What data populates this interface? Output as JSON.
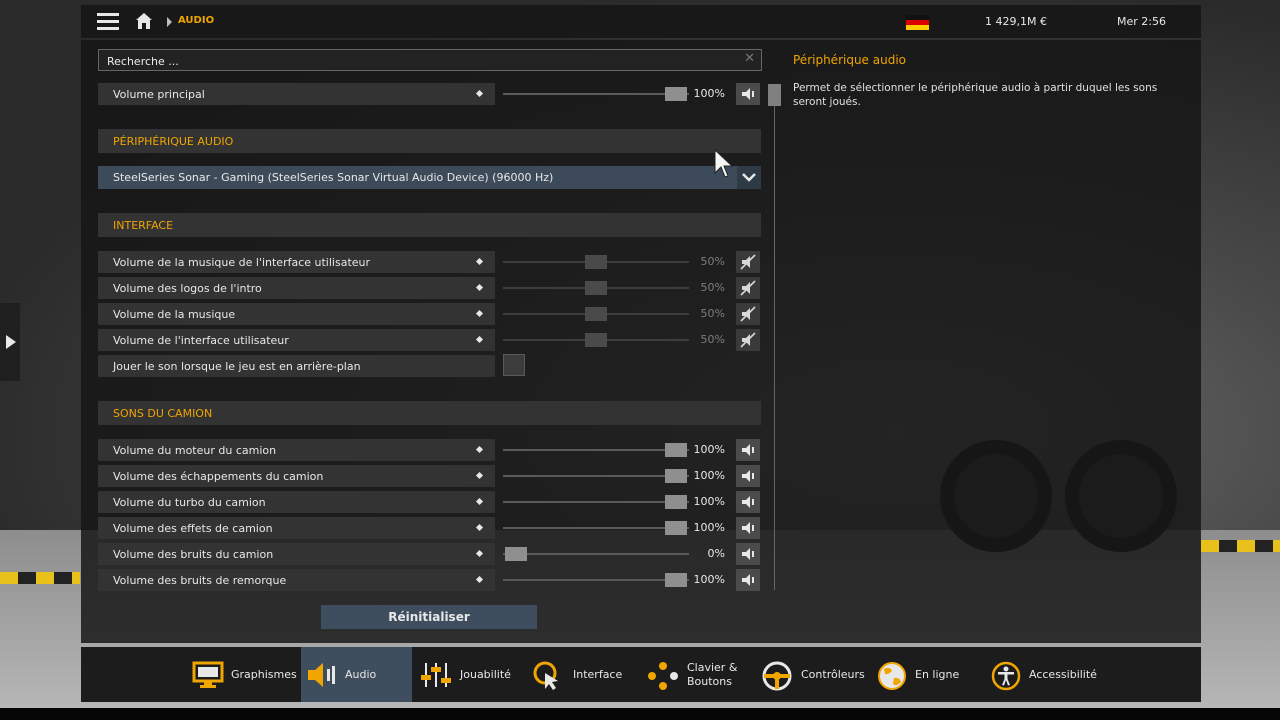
{
  "topbar": {
    "breadcrumb": "AUDIO",
    "money": "1 429,1M  €",
    "clock": "Mer 2:56"
  },
  "search": {
    "placeholder": "Recherche ..."
  },
  "master": {
    "label": "Volume principal",
    "value": "100%",
    "level": 1.0
  },
  "device_section": {
    "title": "PÉRIPHÉRIQUE AUDIO",
    "selected": "SteelSeries Sonar - Gaming (SteelSeries Sonar Virtual Audio Device) (96000 Hz)"
  },
  "interface_section": {
    "title": "INTERFACE",
    "sliders": [
      {
        "label": "Volume de la musique de l'interface utilisateur",
        "value": "50%",
        "level": 0.5
      },
      {
        "label": "Volume des logos de l'intro",
        "value": "50%",
        "level": 0.5
      },
      {
        "label": "Volume de la musique",
        "value": "50%",
        "level": 0.5
      },
      {
        "label": "Volume de l'interface utilisateur",
        "value": "50%",
        "level": 0.5
      }
    ],
    "background_sound_label": "Jouer le son lorsque le jeu est en arrière-plan"
  },
  "truck_section": {
    "title": "SONS DU CAMION",
    "sliders": [
      {
        "label": "Volume du moteur du camion",
        "value": "100%",
        "level": 1.0
      },
      {
        "label": "Volume des échappements du camion",
        "value": "100%",
        "level": 1.0
      },
      {
        "label": "Volume du turbo du camion",
        "value": "100%",
        "level": 1.0
      },
      {
        "label": "Volume des effets de camion",
        "value": "100%",
        "level": 1.0
      },
      {
        "label": "Volume des bruits du camion",
        "value": "0%",
        "level": 0.0
      },
      {
        "label": "Volume des bruits de remorque",
        "value": "100%",
        "level": 1.0
      }
    ]
  },
  "reset_label": "Réinitialiser",
  "info": {
    "title": "Périphérique audio",
    "text": "Permet de sélectionner le périphérique audio à partir duquel les sons seront joués."
  },
  "nav": {
    "graphics": "Graphismes",
    "audio": "Audio",
    "gameplay": "Jouabilité",
    "interface": "Interface",
    "keyboard_line1": "Clavier &",
    "keyboard_line2": "Boutons",
    "controllers": "Contrôleurs",
    "online": "En ligne",
    "accessibility": "Accessibilité"
  },
  "colors": {
    "accent": "#f0a500",
    "selected": "#3f4e5f"
  }
}
